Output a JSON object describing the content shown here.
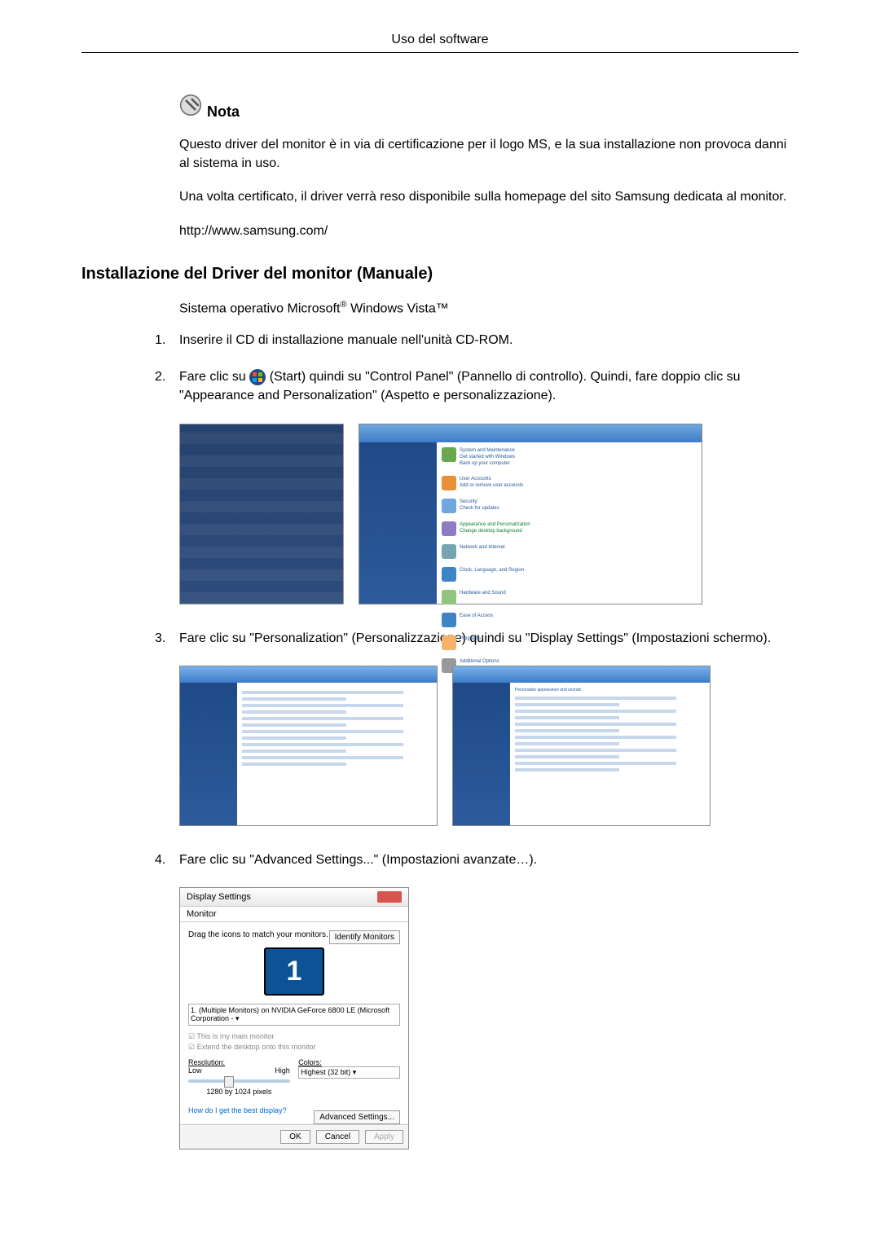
{
  "header": {
    "title": "Uso del software"
  },
  "note": {
    "label": "Nota",
    "p1": "Questo driver del monitor è in via di certificazione per il logo MS, e la sua installazione non provoca danni al sistema in uso.",
    "p2": "Una volta certificato, il driver verrà reso disponibile sulla homepage del sito Samsung dedicata al monitor.",
    "url": "http://www.samsung.com/"
  },
  "section": {
    "heading": "Installazione del Driver del monitor (Manuale)",
    "os_line_prefix": "Sistema operativo Microsoft",
    "os_line_suffix": " Windows Vista™"
  },
  "steps": {
    "s1": {
      "num": "1.",
      "text": "Inserire il CD di installazione manuale nell'unità CD-ROM."
    },
    "s2": {
      "num": "2.",
      "pre": "Fare clic su ",
      "post": "(Start) quindi su \"Control Panel\" (Pannello di controllo). Quindi, fare doppio clic su \"Appearance and Personalization\" (Aspetto e personalizzazione)."
    },
    "s3": {
      "num": "3.",
      "text": "Fare clic su \"Personalization\" (Personalizzazione) quindi su \"Display Settings\" (Impostazioni schermo)."
    },
    "s4": {
      "num": "4.",
      "text": "Fare clic su \"Advanced Settings...\" (Impostazioni avanzate…)."
    }
  },
  "dialog": {
    "title": "Display Settings",
    "tab": "Monitor",
    "drag": "Drag the icons to match your monitors.",
    "identify": "Identify Monitors",
    "monitor_num": "1",
    "device": "1. (Multiple Monitors) on NVIDIA GeForce 6800 LE (Microsoft Corporation - ▾",
    "chk_main": "This is my main monitor",
    "chk_extend": "Extend the desktop onto this monitor",
    "res_label": "Resolution:",
    "res_low": "Low",
    "res_high": "High",
    "res_val": "1280 by 1024 pixels",
    "color_label": "Colors:",
    "color_val": "Highest (32 bit)   ▾",
    "help_link": "How do I get the best display?",
    "advanced": "Advanced Settings...",
    "ok": "OK",
    "cancel": "Cancel",
    "apply": "Apply"
  }
}
